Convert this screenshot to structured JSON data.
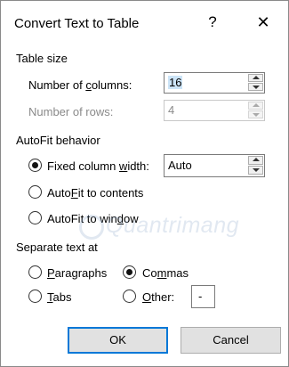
{
  "window": {
    "title": "Convert Text to Table",
    "help_glyph": "?",
    "close_glyph": "✕"
  },
  "table_size": {
    "heading": "Table size",
    "columns_label_prefix": "Number of ",
    "columns_label_underlined": "c",
    "columns_label_suffix": "olumns:",
    "columns_value": "16",
    "rows_label": "Number of rows:",
    "rows_value": "4"
  },
  "autofit": {
    "heading": "AutoFit behavior",
    "fixed_label_prefix": "Fixed column ",
    "fixed_label_underlined": "w",
    "fixed_label_suffix": "idth:",
    "fixed_value": "Auto",
    "contents_label_prefix": "Auto",
    "contents_label_underlined": "F",
    "contents_label_suffix": "it to contents",
    "window_label_prefix": "AutoFit to win",
    "window_label_underlined": "d",
    "window_label_suffix": "ow",
    "selected": "fixed"
  },
  "separate": {
    "heading": "Separate text at",
    "paragraphs_label_underlined": "P",
    "paragraphs_label_suffix": "aragraphs",
    "commas_label_prefix": "Co",
    "commas_label_underlined": "m",
    "commas_label_suffix": "mas",
    "tabs_label_underlined": "T",
    "tabs_label_suffix": "abs",
    "other_label_underlined": "O",
    "other_label_suffix": "ther:",
    "other_value": "-",
    "selected": "commas"
  },
  "footer": {
    "ok_label": "OK",
    "cancel_label": "Cancel"
  },
  "watermark": {
    "text": "Quantrimang"
  }
}
